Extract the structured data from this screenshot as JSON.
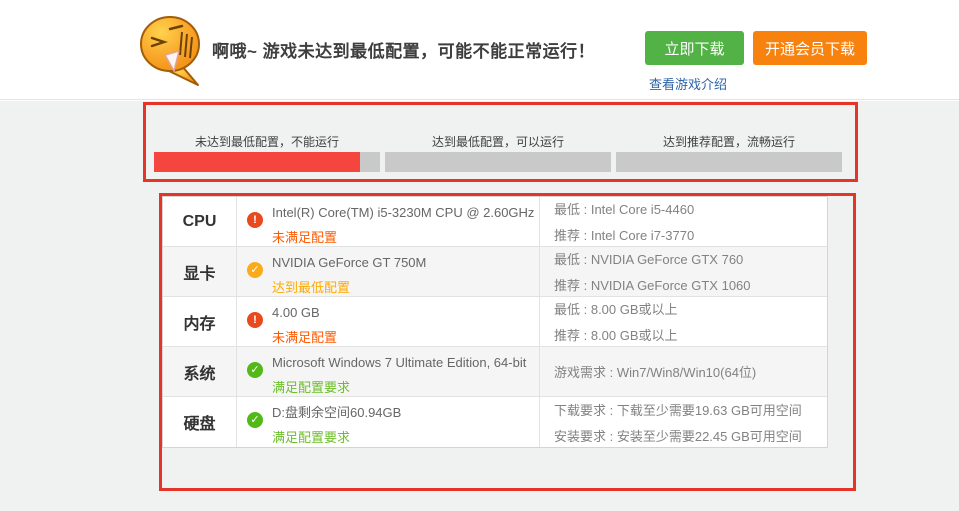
{
  "header": {
    "emoji_icon": "embarrassed-face",
    "title": "啊哦~ 游戏未达到最低配置，可能不能正常运行！",
    "download_button": "立即下载",
    "vip_download_button": "开通会员下载",
    "game_intro_link": "查看游戏介绍"
  },
  "gauge": {
    "segments": [
      {
        "label": "未达到最低配置，不能运行",
        "fill_percent": 91
      },
      {
        "label": "达到最低配置，可以运行",
        "fill_percent": 0
      },
      {
        "label": "达到推荐配置，流畅运行",
        "fill_percent": 0
      }
    ]
  },
  "table": {
    "rows": [
      {
        "label": "CPU",
        "status_type": "fail",
        "icon": "!",
        "value": "Intel(R) Core(TM) i5-3230M CPU @ 2.60GHz",
        "status": "未满足配置",
        "req1": "最低 : Intel Core i5-4460",
        "req2": "推荐 : Intel Core i7-3770"
      },
      {
        "label": "显卡",
        "status_type": "warn",
        "icon": "✓",
        "value": "NVIDIA GeForce GT 750M",
        "status": "达到最低配置",
        "req1": "最低 : NVIDIA GeForce GTX 760",
        "req2": "推荐 : NVIDIA GeForce GTX 1060"
      },
      {
        "label": "内存",
        "status_type": "fail",
        "icon": "!",
        "value": "4.00 GB",
        "status": "未满足配置",
        "req1": "最低 : 8.00 GB或以上",
        "req2": "推荐 : 8.00 GB或以上"
      },
      {
        "label": "系统",
        "status_type": "ok",
        "icon": "✓",
        "value": "Microsoft Windows 7 Ultimate Edition, 64-bit",
        "status": "满足配置要求",
        "req1": "游戏需求 : Win7/Win8/Win10(64位)",
        "req2": ""
      },
      {
        "label": "硬盘",
        "status_type": "ok",
        "icon": "✓",
        "value": "D:盘剩余空间60.94GB",
        "status": "满足配置要求",
        "req1": "下载要求 : 下载至少需要19.63 GB可用空间",
        "req2": "安装要求 : 安装至少需要22.45 GB可用空间"
      }
    ]
  },
  "colors": {
    "annotation_red": "#e53528",
    "bar_red": "#f4453f",
    "bar_gray": "#c9c9c9",
    "button_green": "#52b245",
    "button_orange": "#f8820e",
    "link_blue": "#2d64a7",
    "status_fail": "#ff5a00",
    "status_warn": "#ffaa00",
    "status_ok": "#6cbf2a"
  }
}
